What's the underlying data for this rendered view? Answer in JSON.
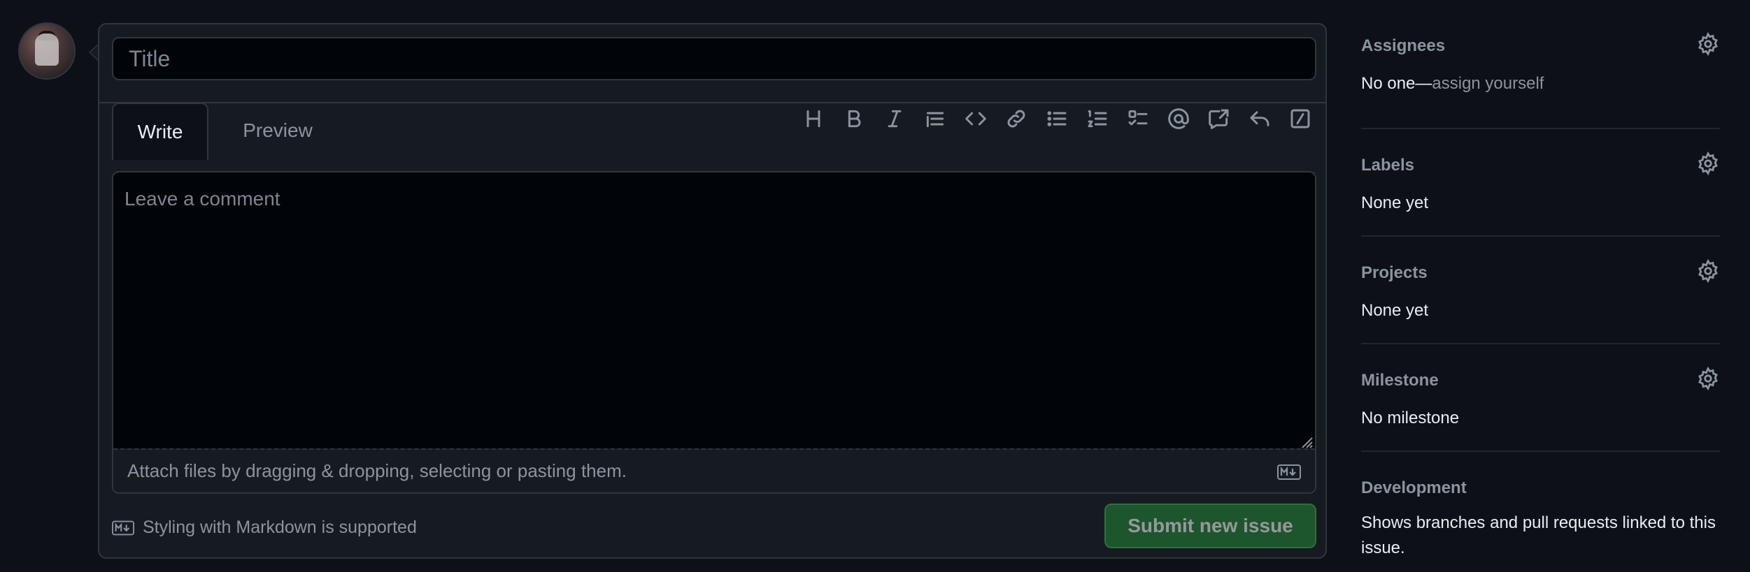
{
  "title_input": {
    "placeholder": "Title"
  },
  "tabs": {
    "write": "Write",
    "preview": "Preview"
  },
  "toolbar": {
    "icons": [
      "heading-icon",
      "bold-icon",
      "italic-icon",
      "quote-icon",
      "code-icon",
      "link-icon",
      "bulleted-list-icon",
      "numbered-list-icon",
      "task-list-icon",
      "mention-icon",
      "cross-reference-icon",
      "saved-reply-icon",
      "slash-command-icon"
    ]
  },
  "comment": {
    "placeholder": "Leave a comment",
    "attach_text": "Attach files by dragging & dropping, selecting or pasting them."
  },
  "footer": {
    "markdown_note": "Styling with Markdown is supported",
    "submit_label": "Submit new issue"
  },
  "sidebar": {
    "assignees": {
      "title": "Assignees",
      "value": "No one—",
      "link": "assign yourself"
    },
    "labels": {
      "title": "Labels",
      "value": "None yet"
    },
    "projects": {
      "title": "Projects",
      "value": "None yet"
    },
    "milestone": {
      "title": "Milestone",
      "value": "No milestone"
    },
    "development": {
      "title": "Development",
      "value": "Shows branches and pull requests linked to this issue."
    }
  },
  "colors": {
    "background": "#0d1117",
    "submit": "#238636",
    "muted": "#8b949e"
  }
}
